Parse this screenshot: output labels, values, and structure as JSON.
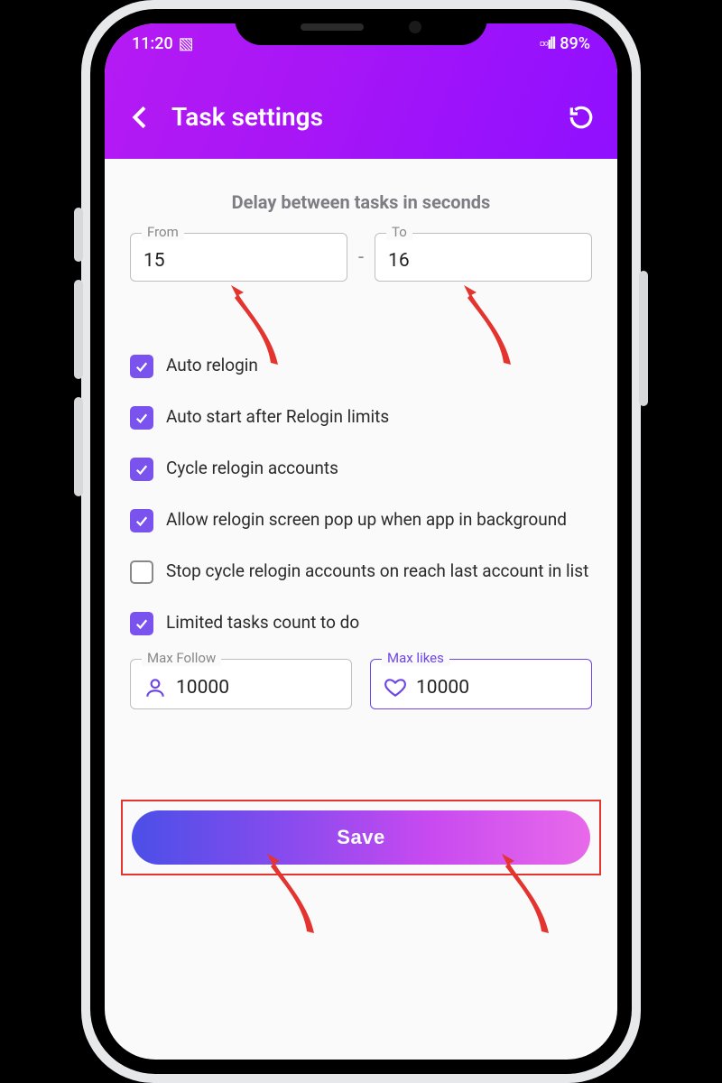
{
  "statusbar": {
    "time": "11:20",
    "battery": "89%"
  },
  "header": {
    "title": "Task settings"
  },
  "delay": {
    "section_title": "Delay between tasks in seconds",
    "from_label": "From",
    "from_value": "15",
    "to_label": "To",
    "to_value": "16",
    "separator": "-"
  },
  "checks": {
    "auto_relogin": "Auto relogin",
    "auto_start": "Auto start after Relogin limits",
    "cycle_relogin": "Cycle relogin accounts",
    "allow_popup": "Allow relogin screen pop up when app in background",
    "stop_cycle": "Stop cycle relogin accounts on reach last account in list",
    "limited_tasks": "Limited tasks count to do"
  },
  "limits": {
    "max_follow_label": "Max Follow",
    "max_follow_value": "10000",
    "max_likes_label": "Max likes",
    "max_likes_value": "10000"
  },
  "buttons": {
    "save": "Save"
  }
}
